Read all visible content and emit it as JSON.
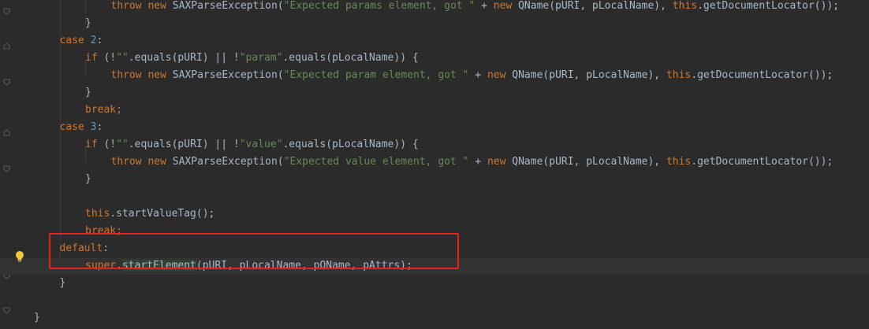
{
  "editor": {
    "lines": [
      {
        "indent": 2,
        "tokens": [
          {
            "t": "throw new ",
            "c": "kw"
          },
          {
            "t": "SAXParseException(",
            "c": "plain"
          },
          {
            "t": "\"Expected params element, got \"",
            "c": "str"
          },
          {
            "t": " + ",
            "c": "plain"
          },
          {
            "t": "new ",
            "c": "kw"
          },
          {
            "t": "QName(pURI, pLocalName), ",
            "c": "plain"
          },
          {
            "t": "this",
            "c": "kw"
          },
          {
            "t": ".getDocumentLocator());",
            "c": "plain"
          }
        ]
      },
      {
        "indent": 1,
        "tokens": [
          {
            "t": "}",
            "c": "plain"
          }
        ]
      },
      {
        "indent": 0,
        "tokens": [
          {
            "t": "case ",
            "c": "kw"
          },
          {
            "t": "2",
            "c": "num"
          },
          {
            "t": ":",
            "c": "plain"
          }
        ]
      },
      {
        "indent": 1,
        "tokens": [
          {
            "t": "if ",
            "c": "kw"
          },
          {
            "t": "(!",
            "c": "plain"
          },
          {
            "t": "\"\"",
            "c": "str"
          },
          {
            "t": ".equals(pURI) || !",
            "c": "plain"
          },
          {
            "t": "\"param\"",
            "c": "str"
          },
          {
            "t": ".equals(pLocalName)) {",
            "c": "plain"
          }
        ]
      },
      {
        "indent": 2,
        "tokens": [
          {
            "t": "throw new ",
            "c": "kw"
          },
          {
            "t": "SAXParseException(",
            "c": "plain"
          },
          {
            "t": "\"Expected param element, got \"",
            "c": "str"
          },
          {
            "t": " + ",
            "c": "plain"
          },
          {
            "t": "new ",
            "c": "kw"
          },
          {
            "t": "QName(pURI, pLocalName), ",
            "c": "plain"
          },
          {
            "t": "this",
            "c": "kw"
          },
          {
            "t": ".getDocumentLocator());",
            "c": "plain"
          }
        ]
      },
      {
        "indent": 1,
        "tokens": [
          {
            "t": "}",
            "c": "plain"
          }
        ]
      },
      {
        "indent": 1,
        "tokens": [
          {
            "t": "break",
            "c": "kw"
          },
          {
            "t": ";",
            "c": "kw"
          }
        ]
      },
      {
        "indent": 0,
        "tokens": [
          {
            "t": "case ",
            "c": "kw"
          },
          {
            "t": "3",
            "c": "num"
          },
          {
            "t": ":",
            "c": "plain"
          }
        ]
      },
      {
        "indent": 1,
        "tokens": [
          {
            "t": "if ",
            "c": "kw"
          },
          {
            "t": "(!",
            "c": "plain"
          },
          {
            "t": "\"\"",
            "c": "str"
          },
          {
            "t": ".equals(pURI) || !",
            "c": "plain"
          },
          {
            "t": "\"value\"",
            "c": "str"
          },
          {
            "t": ".equals(pLocalName)) {",
            "c": "plain"
          }
        ]
      },
      {
        "indent": 2,
        "tokens": [
          {
            "t": "throw new ",
            "c": "kw"
          },
          {
            "t": "SAXParseException(",
            "c": "plain"
          },
          {
            "t": "\"Expected value element, got \"",
            "c": "str"
          },
          {
            "t": " + ",
            "c": "plain"
          },
          {
            "t": "new ",
            "c": "kw"
          },
          {
            "t": "QName(pURI, pLocalName), ",
            "c": "plain"
          },
          {
            "t": "this",
            "c": "kw"
          },
          {
            "t": ".getDocumentLocator());",
            "c": "plain"
          }
        ]
      },
      {
        "indent": 1,
        "tokens": [
          {
            "t": "}",
            "c": "plain"
          }
        ]
      },
      {
        "indent": 0,
        "tokens": []
      },
      {
        "indent": 1,
        "tokens": [
          {
            "t": "this",
            "c": "kw"
          },
          {
            "t": ".startValueTag();",
            "c": "plain"
          }
        ]
      },
      {
        "indent": 1,
        "tokens": [
          {
            "t": "break",
            "c": "kw"
          },
          {
            "t": ";",
            "c": "kw"
          }
        ]
      },
      {
        "indent": 0,
        "tokens": [
          {
            "t": "default",
            "c": "kw"
          },
          {
            "t": ":",
            "c": "plain"
          }
        ]
      },
      {
        "indent": 1,
        "current": true,
        "tokens": [
          {
            "t": "super",
            "c": "kw"
          },
          {
            "t": ".",
            "c": "plain"
          },
          {
            "t": "startElement",
            "c": "plain",
            "hl": true
          },
          {
            "t": "(pURI, pLocalName, pQName, pAttrs);",
            "c": "plain"
          }
        ]
      },
      {
        "indent": 0,
        "tokens": [
          {
            "t": "}",
            "c": "plain"
          }
        ]
      },
      {
        "indent": 0,
        "tokens": []
      },
      {
        "indent": -1,
        "tokens": [
          {
            "t": "}",
            "c": "plain"
          }
        ]
      }
    ]
  },
  "colors": {
    "background": "#2b2b2b",
    "keyword": "#cc7832",
    "number": "#6897bb",
    "string": "#6a8759",
    "text": "#a9b7c6",
    "highlight_box": "#e0251b"
  },
  "gutter_icons": [
    "fold-marker-icon",
    "lightbulb-icon"
  ]
}
